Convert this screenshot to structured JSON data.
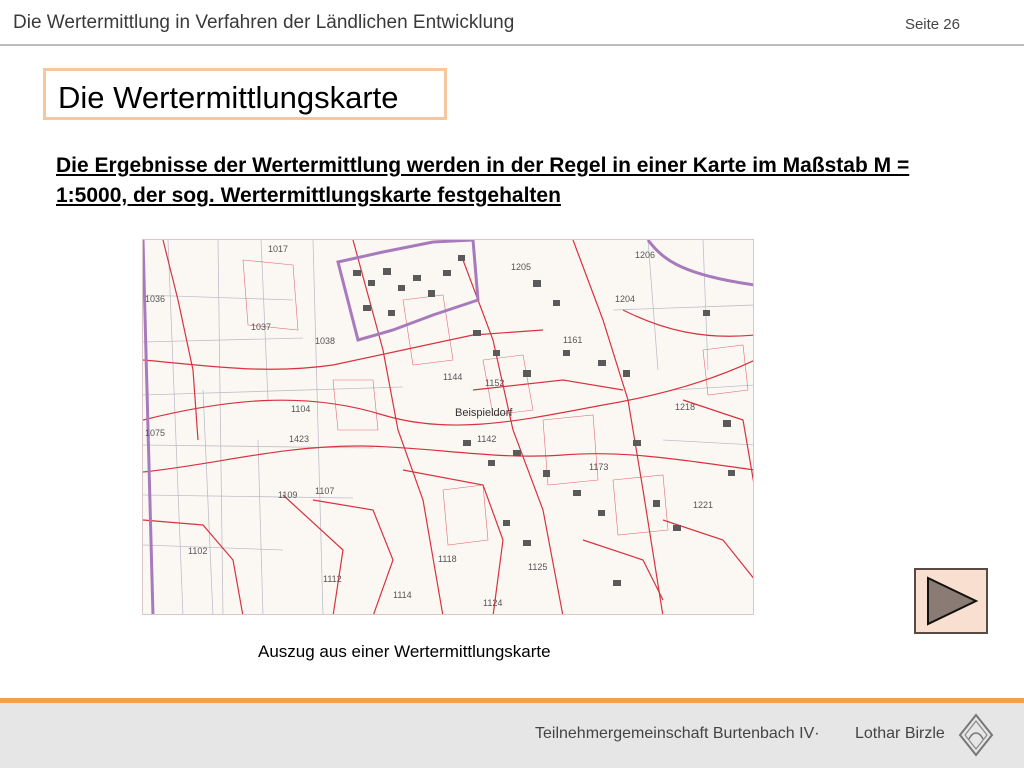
{
  "header": {
    "title": "Die Wertermittlung in Verfahren der Ländlichen Entwicklung",
    "page_label": "Seite 26"
  },
  "slide": {
    "title": "Die Wertermittlungskarte",
    "lead_text": "Die Ergebnisse der Wertermittlung werden in der Regel in einer Karte im Maßstab M = 1:5000, der sog. Wertermittlungskarte festgehalten",
    "caption": "Auszug aus einer Wertermittlungskarte"
  },
  "map": {
    "village_label": "Beispieldorf",
    "parcel_labels": [
      "1017",
      "1036",
      "1037",
      "1038",
      "1104",
      "1423",
      "1075",
      "1109",
      "1107",
      "1102",
      "1112",
      "1118",
      "1114",
      "1124",
      "1142",
      "1152",
      "1144",
      "1161",
      "1173",
      "1125",
      "1218",
      "1221",
      "1204",
      "1205",
      "1206"
    ]
  },
  "navigation": {
    "next_icon": "play-triangle-icon"
  },
  "footer": {
    "organization": "Teilnehmergemeinschaft Burtenbach IV·",
    "author": "Lothar Birzle",
    "logo_icon": "diamond-seal-icon"
  },
  "colors": {
    "accent_orange": "#f2a04c",
    "title_border": "#f4c79f",
    "button_fill": "#f8dfcf",
    "map_red": "#d8323f",
    "map_purple": "#a77bbb"
  }
}
